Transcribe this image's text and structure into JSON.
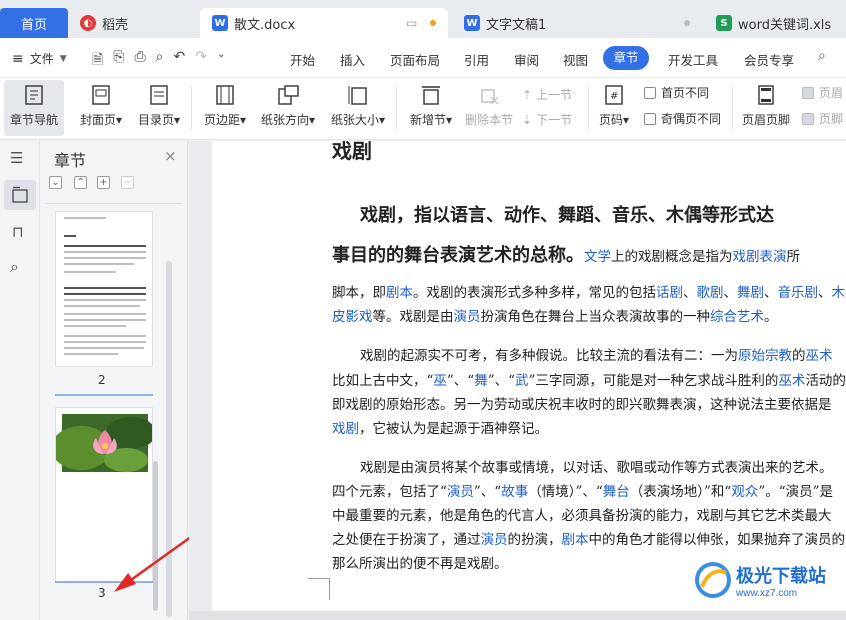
{
  "tabs": {
    "home": "首页",
    "daoke": "稻壳",
    "doc": "散文.docx",
    "doc2": "文字文稿1",
    "xls": "word关键词.xls"
  },
  "menu": {
    "file": "文件",
    "items": [
      "开始",
      "插入",
      "页面布局",
      "引用",
      "审阅",
      "视图"
    ],
    "active": "章节",
    "dev": "开发工具",
    "vip": "会员专享",
    "search_icon": "search-icon"
  },
  "ribbon": {
    "nav": "章节导航",
    "cover": "封面页",
    "toc": "目录页",
    "margin": "页边距",
    "orientation": "纸张方向",
    "size": "纸张大小",
    "new_section": "新增节",
    "delete_section": "删除本节",
    "prev_section": "上一节",
    "next_section": "下一节",
    "page_no": "页码",
    "first_diff": "首页不同",
    "oddeven_diff": "奇偶页不同",
    "header_footer": "页眉页脚",
    "header_r": "页眉",
    "footer_r": "页脚"
  },
  "panel": {
    "title": "章节",
    "thumb2_label": "2",
    "thumb3_label": "3"
  },
  "doc": {
    "title": "戏剧",
    "h1": "戏剧，指以语言、动作、舞蹈、音乐、木偶等形式达",
    "h2": "事目的的舞台表演艺术的总称。",
    "h2_link1": "文学",
    "h2_rest1": "上的戏剧概念是指为",
    "h2_link2": "戏剧表演",
    "h2_rest2": "所",
    "p1a_1": "脚本，即",
    "p1a_link1": "剧本",
    "p1a_2": "。戏剧的表演形式多种多样，常见的包括",
    "p1a_link2": "话剧",
    "p1a_3": "、",
    "p1a_link3": "歌剧",
    "p1a_4": "、",
    "p1a_link4": "舞剧",
    "p1a_5": "、",
    "p1a_link5": "音乐剧",
    "p1a_6": "、",
    "p1a_link6": "木",
    "p1b_link1": "皮影戏",
    "p1b_1": "等。戏剧是由",
    "p1b_link2": "演员",
    "p1b_2": "扮演角色在舞台上当众表演故事的一种",
    "p1b_link3": "综合艺术",
    "p1b_3": "。",
    "p2a_1": "戏剧的起源实不可考，有多种假说。比较主流的看法有二：一为",
    "p2a_link1": "原始宗教",
    "p2a_2": "的",
    "p2a_link2": "巫术",
    "p2b_1": "比如上古中文，“",
    "p2b_link1": "巫",
    "p2b_2": "”、“",
    "p2b_link2": "舞",
    "p2b_3": "”、“",
    "p2b_link3": "武",
    "p2b_4": "”三字同源，可能是对一种乞求战斗胜利的",
    "p2b_link4": "巫术",
    "p2b_5": "活动的",
    "p2c": "即戏剧的原始形态。另一为劳动或庆祝丰收时的即兴歌舞表演，这种说法主要依据是",
    "p2d_link1": "戏剧",
    "p2d_1": "，它被认为是起源于酒神祭记。",
    "p3a": "戏剧是由演员将某个故事或情境，以对话、歌唱或动作等方式表演出来的艺术。",
    "p3b_1": "四个元素，包括了“",
    "p3b_link1": "演员",
    "p3b_2": "”、“",
    "p3b_link2": "故事",
    "p3b_3": "（情境）”、“",
    "p3b_link3": "舞台",
    "p3b_4": "（表演场地）”和“",
    "p3b_link4": "观众",
    "p3b_5": "”。“演员”是",
    "p3c": "中最重要的元素，他是角色的代言人，必须具备扮演的能力，戏剧与其它艺术类最大",
    "p3d_1": "之处便在于扮演了，通过",
    "p3d_link1": "演员",
    "p3d_2": "的扮演，",
    "p3d_link2": "剧本",
    "p3d_3": "中的角色才能得以伸张，如果抛弃了演员的",
    "p3e": "那么所演出的便不再是戏剧。"
  },
  "watermark": {
    "name": "极光下载站",
    "url": "www.xz7.com"
  },
  "colors": {
    "accent": "#3370e6",
    "link": "#1f5fcc",
    "arrow": "#e02a2a"
  }
}
